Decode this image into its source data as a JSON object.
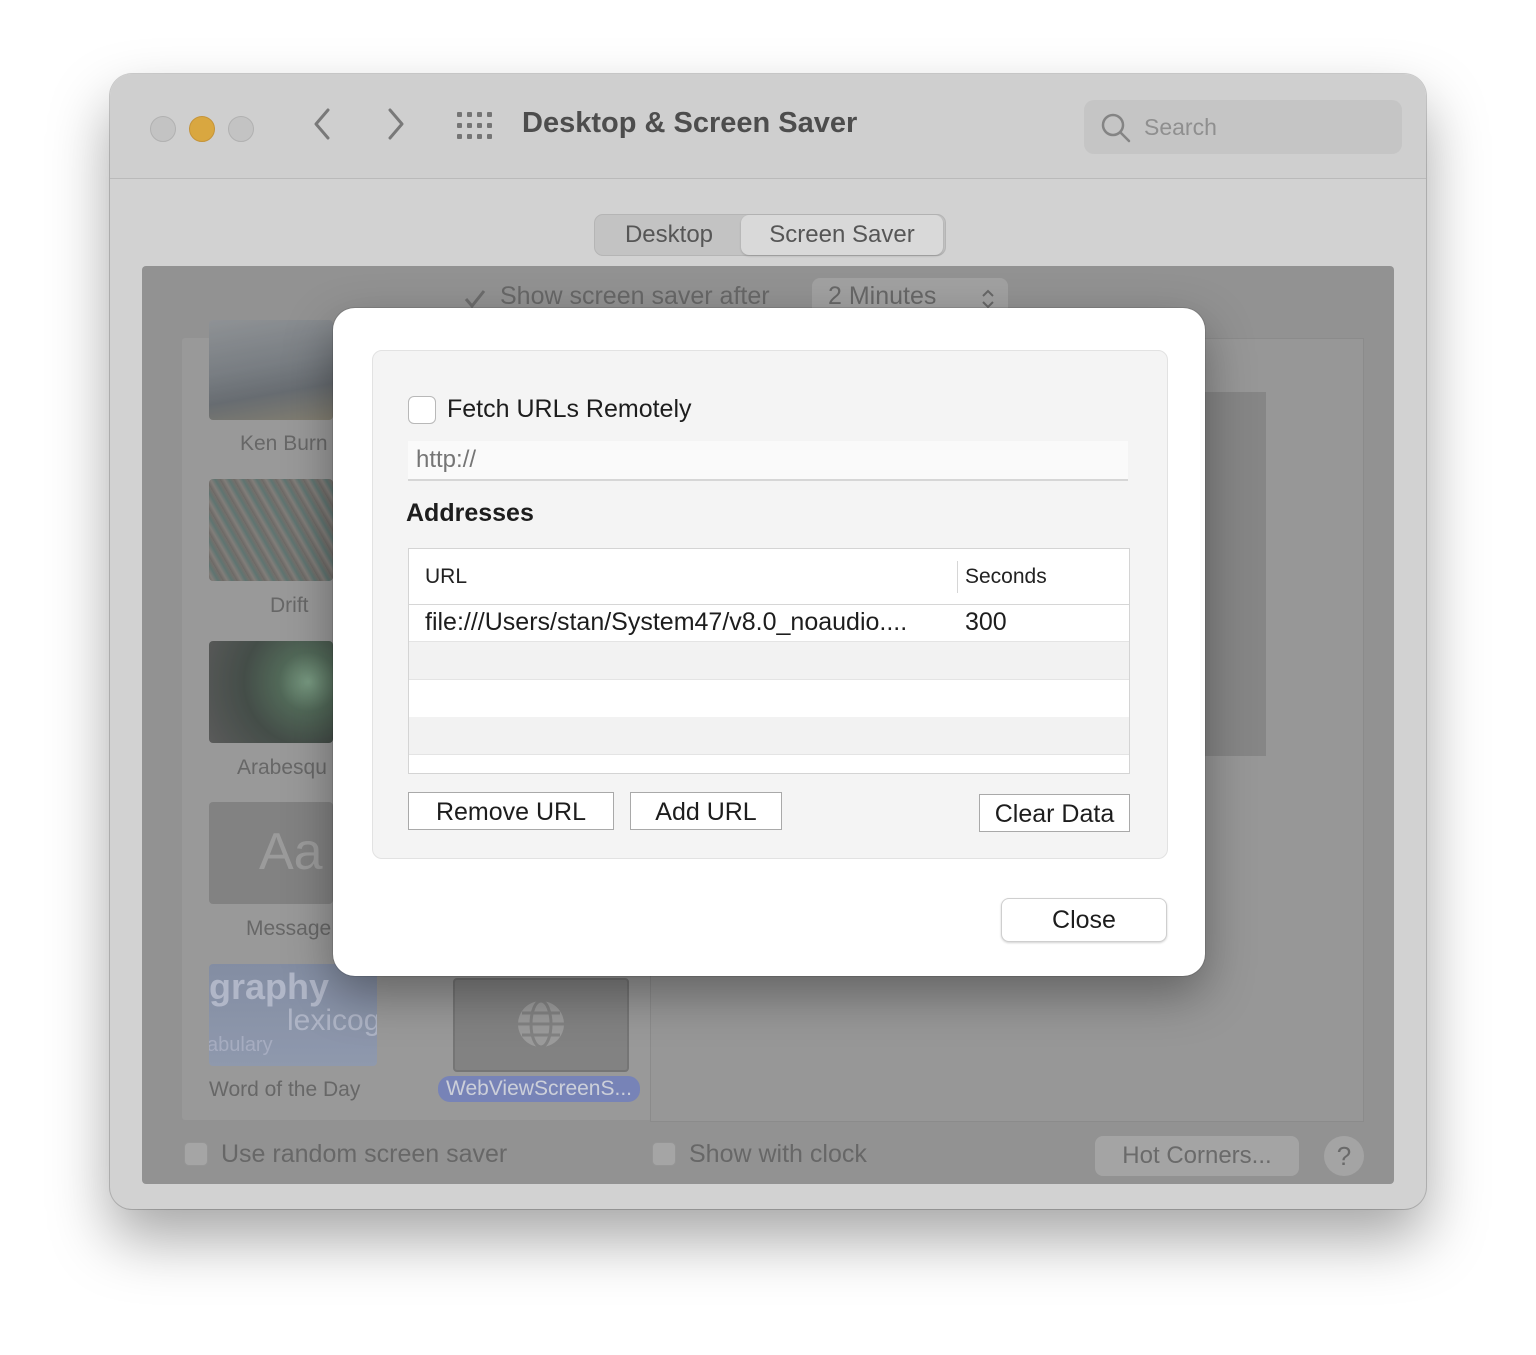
{
  "window": {
    "title": "Desktop & Screen Saver",
    "search_placeholder": "Search",
    "tabs": [
      {
        "label": "Desktop",
        "active": false
      },
      {
        "label": "Screen Saver",
        "active": true
      }
    ],
    "show_after_label": "Show screen saver after",
    "show_after_value": "2 Minutes",
    "savers": [
      {
        "label": "Ken Burn"
      },
      {
        "label": "Drift"
      },
      {
        "label": "Arabesqu"
      },
      {
        "label": "Message",
        "thumb_text": "Aa"
      },
      {
        "label": "Word of the Day",
        "thumb_words": [
          "graphy",
          "lexicog",
          "abulary"
        ]
      },
      {
        "label": "WebViewScreenS...",
        "selected": true
      }
    ],
    "random_label": "Use random screen saver",
    "clock_label": "Show with clock",
    "hot_corners_label": "Hot Corners...",
    "help_label": "?"
  },
  "sheet": {
    "fetch_label": "Fetch URLs Remotely",
    "fetch_checked": false,
    "url_placeholder": "http://",
    "addresses_title": "Addresses",
    "columns": {
      "url": "URL",
      "seconds": "Seconds"
    },
    "rows": [
      {
        "url": "file:///Users/stan/System47/v8.0_noaudio....",
        "seconds": "300"
      }
    ],
    "buttons": {
      "remove": "Remove URL",
      "add": "Add URL",
      "clear": "Clear Data",
      "close": "Close"
    }
  },
  "colors": {
    "close_light": "#d6d6d6",
    "minimize_light": "#f5b83a",
    "zoom_light": "#d6d6d6",
    "selected_label": "#7d8ccb"
  },
  "icons": [
    "chevron-left-icon",
    "chevron-right-icon",
    "grid-icon",
    "search-icon",
    "globe-icon",
    "checkmark-icon",
    "stepper-icon"
  ]
}
